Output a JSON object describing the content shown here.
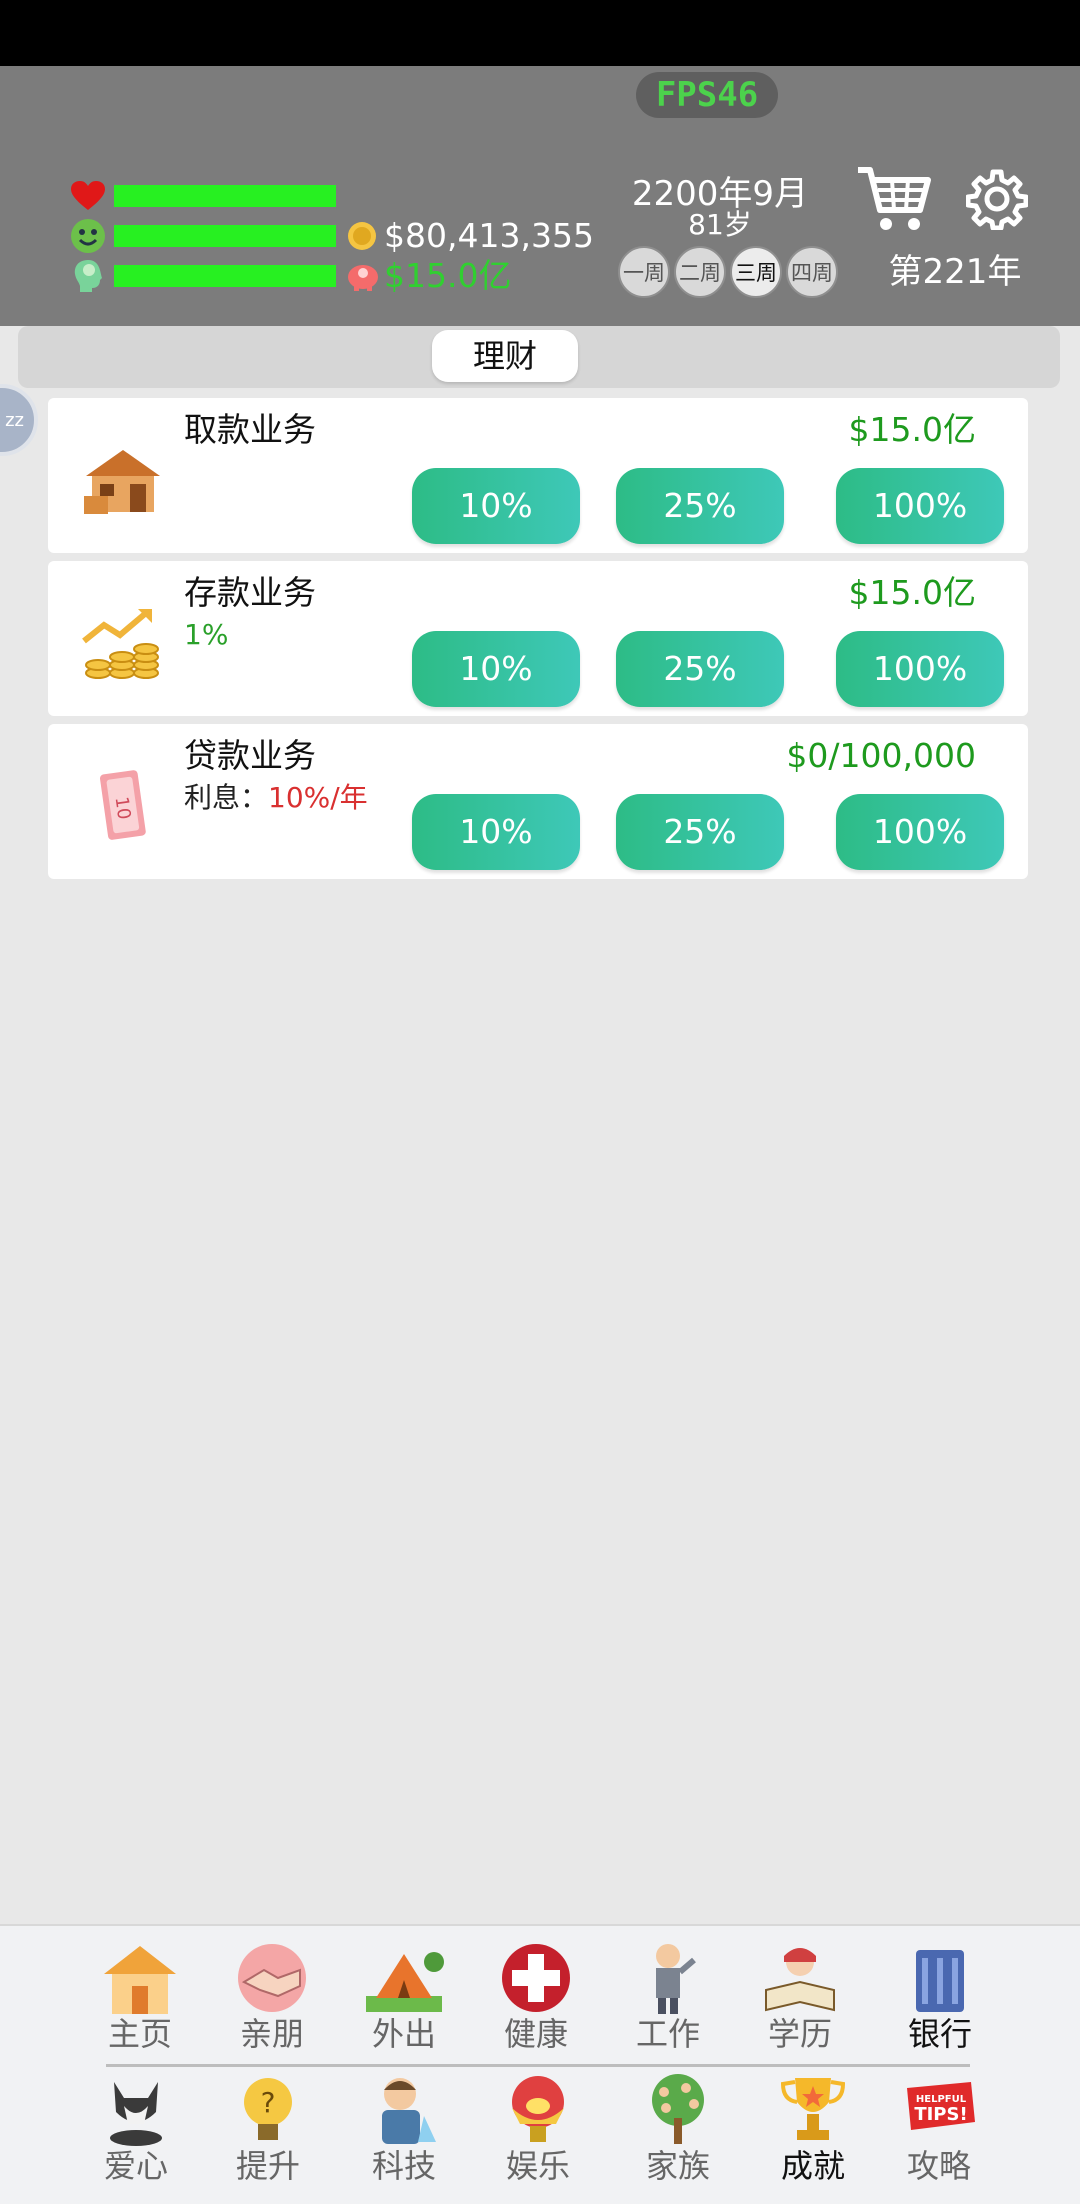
{
  "header": {
    "fps": "FPS46",
    "money": "$80,413,355",
    "savings": "$15.0亿",
    "date": "2200年9月",
    "age": "81岁",
    "weeks": [
      "一周",
      "二周",
      "三周",
      "四周"
    ],
    "active_week": "三周",
    "year": "第221年",
    "cart_icon": "shopping-cart-icon",
    "settings_icon": "gear-icon",
    "colors": {
      "bar": "#27f021",
      "header_bg": "#7c7c7c",
      "savings_text": "#30d030"
    }
  },
  "tab": {
    "label": "理财"
  },
  "side_bubble": {
    "text": "zz"
  },
  "cards": [
    {
      "title": "取款业务",
      "value": "$15.0亿",
      "icon": "withdraw-house-icon",
      "buttons": [
        "10%",
        "25%",
        "100%"
      ]
    },
    {
      "title": "存款业务",
      "subtitle": "1%",
      "value": "$15.0亿",
      "icon": "coins-growth-icon",
      "buttons": [
        "10%",
        "25%",
        "100%"
      ]
    },
    {
      "title": "贷款业务",
      "subtitle_label": "利息：",
      "subtitle_value": "10%/年",
      "value": "$0/100,000",
      "icon": "banknote-icon",
      "buttons": [
        "10%",
        "25%",
        "100%"
      ]
    }
  ],
  "nav": {
    "row1": [
      "主页",
      "亲朋",
      "外出",
      "健康",
      "工作",
      "学历",
      "银行"
    ],
    "row2": [
      "爱心",
      "提升",
      "科技",
      "娱乐",
      "家族",
      "成就",
      "攻略"
    ],
    "active": "银行"
  }
}
